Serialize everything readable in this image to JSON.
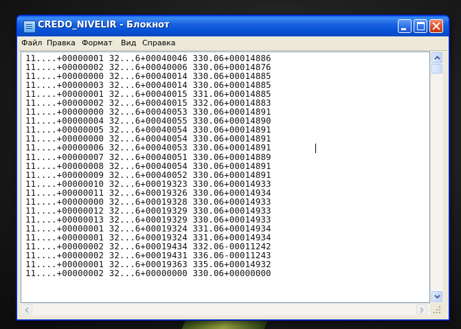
{
  "window": {
    "title": "CREDO_NIVELIR - Блокнот"
  },
  "menu": {
    "items": [
      "Файл",
      "Правка",
      "Формат",
      "Вид",
      "Справка"
    ]
  },
  "document": {
    "lines": [
      "11....+00000001 32...6+00040046 330.06+00014886",
      "11....+00000002 32...6+00040006 330.06+00014876",
      "11....+00000000 32...6+00040014 330.06+00014885",
      "11....+00000003 32...6+00040014 330.06+00014885",
      "11....+00000001 32...6+00040015 331.06+00014885",
      "11....+00000002 32...6+00040015 332.06+00014883",
      "11....+00000000 32...6+00040053 330.06+00014891",
      "11....+00000004 32...6+00040055 330.06+00014890",
      "11....+00000005 32...6+00040054 330.06+00014891",
      "11....+00000000 32...6+00040054 330.06+00014891",
      "11....+00000006 32...6+00040053 330.06+00014891",
      "11....+00000007 32...6+00040051 330.06+00014889",
      "11....+00000008 32...6+00040054 330.06+00014891",
      "11....+00000009 32...6+00040052 330.06+00014891",
      "11....+00000010 32...6+00019323 330.06+00014933",
      "11....+00000011 32...6+00019326 330.06+00014934",
      "11....+00000000 32...6+00019328 330.06+00014933",
      "11....+00000012 32...6+00019329 330.06+00014933",
      "11....+00000013 32...6+00019329 330.06+00014933",
      "11....+00000001 32...6+00019324 331.06+00014934",
      "11....+00000001 32...6+00019324 331.06+00014934",
      "11....+00000002 32...6+00019434 332.06-00011242",
      "11....+00000002 32...6+00019431 336.06-00011243",
      "11....+00000001 32...6+00019363 335.06+00014932",
      "11....+00000002 32...6+00000000 330.06+00000000"
    ]
  },
  "colors": {
    "titlebar": "#0553d6",
    "close_button": "#d84a22",
    "editor_background": "#ffffff",
    "text": "#111111"
  },
  "icons": {
    "app": "notepad-icon",
    "minimize": "minimize-icon",
    "maximize": "maximize-icon",
    "close": "close-icon"
  }
}
